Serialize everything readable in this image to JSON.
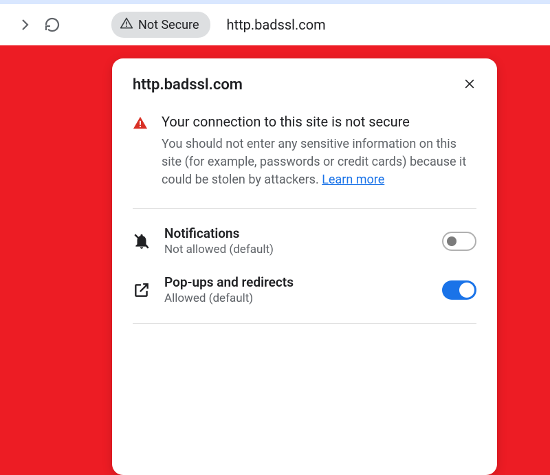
{
  "toolbar": {
    "not_secure_label": "Not Secure",
    "url": "http.badssl.com"
  },
  "popup": {
    "title": "http.badssl.com",
    "security": {
      "heading": "Your connection to this site is not secure",
      "desc": "You should not enter any sensitive information on this site (for example, passwords or credit cards) because it could be stolen by attackers. ",
      "learn_more": "Learn more"
    },
    "permissions": [
      {
        "label": "Notifications",
        "status": "Not allowed (default)",
        "enabled": false
      },
      {
        "label": "Pop-ups and redirects",
        "status": "Allowed (default)",
        "enabled": true
      }
    ]
  }
}
